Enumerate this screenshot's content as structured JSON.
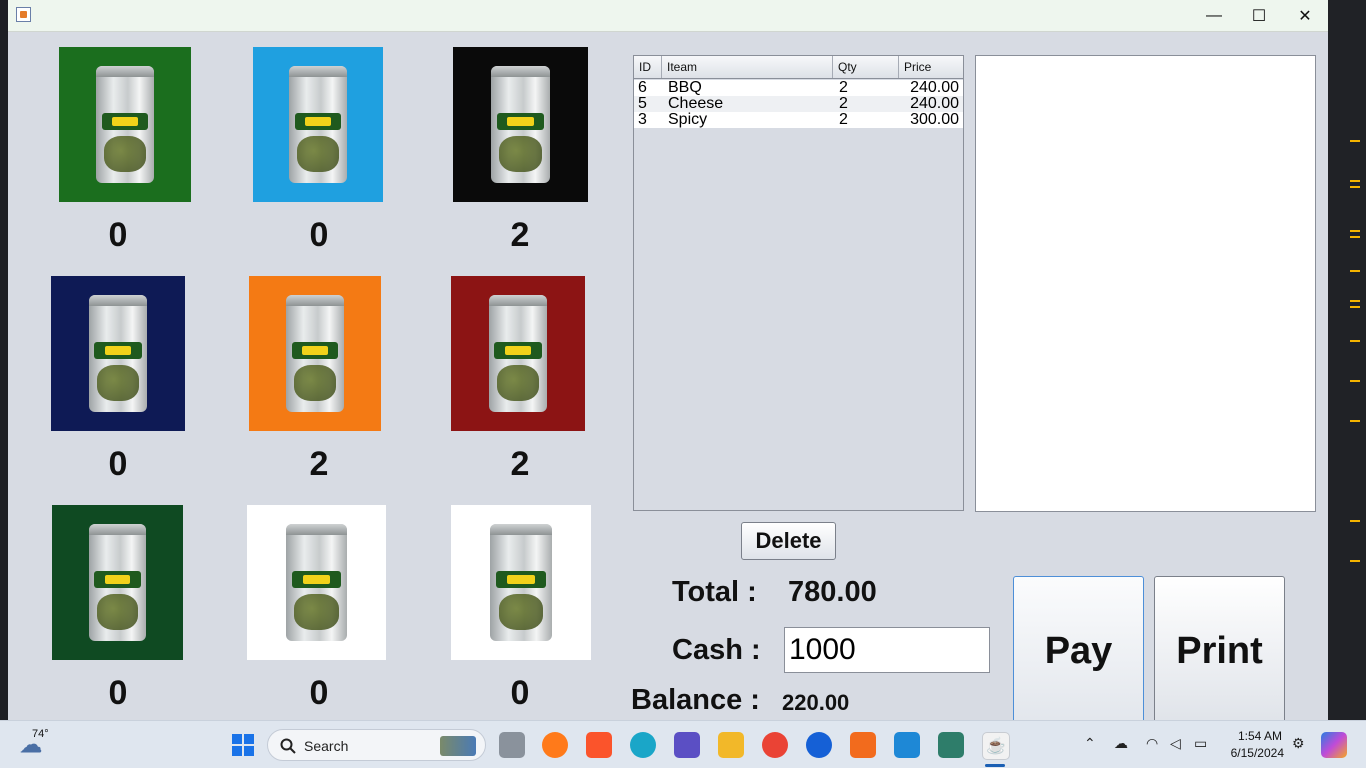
{
  "window": {
    "controls": {
      "minimize": "—",
      "maximize": "☐",
      "close": "✕"
    }
  },
  "products": [
    {
      "count": "0",
      "bg": "#1b6e1e"
    },
    {
      "count": "0",
      "bg": "#1fa0e0"
    },
    {
      "count": "2",
      "bg": "#0a0a0a"
    },
    {
      "count": "0",
      "bg": "#0e1a55"
    },
    {
      "count": "2",
      "bg": "#f47a14"
    },
    {
      "count": "2",
      "bg": "#8c1414"
    },
    {
      "count": "0",
      "bg": "#0f4a22"
    },
    {
      "count": "0",
      "bg": "#ffffff"
    },
    {
      "count": "0",
      "bg": "#ffffff"
    }
  ],
  "order_table": {
    "headers": [
      "ID",
      "Iteam",
      "Qty",
      "Price"
    ],
    "rows": [
      {
        "id": "6",
        "item": "BBQ",
        "qty": "2",
        "price": "240.00"
      },
      {
        "id": "5",
        "item": "Cheese",
        "qty": "2",
        "price": "240.00"
      },
      {
        "id": "3",
        "item": "Spicy",
        "qty": "2",
        "price": "300.00"
      }
    ]
  },
  "actions": {
    "delete_label": "Delete",
    "pay_label": "Pay",
    "print_label": "Print"
  },
  "summary": {
    "total_label": "Total :",
    "total_value": "780.00",
    "cash_label": "Cash :",
    "cash_value": "1000",
    "balance_label": "Balance :",
    "balance_value": "220.00"
  },
  "taskbar": {
    "weather_temp": "74°",
    "search_label": "Search",
    "time": "1:54 AM",
    "date": "6/15/2024"
  }
}
